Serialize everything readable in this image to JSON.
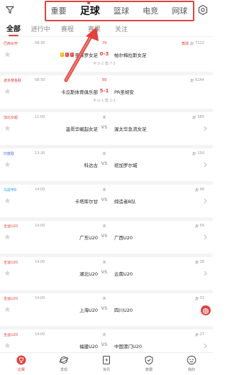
{
  "sport_tabs": [
    "重要",
    "足球",
    "篮球",
    "电竞",
    "网球"
  ],
  "sub_tabs": [
    "全部",
    "进行中",
    "赛程",
    "赛果",
    "关注"
  ],
  "colors": {
    "accent": "#e0433e",
    "card_yellow": "#f2b705"
  },
  "icons": {
    "filter": "filter-icon",
    "settings": "settings-icon",
    "star": "star-icon",
    "chevron": "chevron-right-icon",
    "fans": "people-icon"
  },
  "matches": [
    {
      "league": "巴西女杯",
      "league_color": "#e0433e",
      "time": "08:30",
      "status": "79",
      "tag": "角球",
      "fans": "7122",
      "home": "圣保罗女足",
      "away": "帕尔梅拉斯女足",
      "score": "0-3",
      "half": "半:0-2  角:7-3",
      "home_cards": [
        {
          "type": "y",
          "n": "2"
        },
        {
          "type": "r",
          "n": "1"
        },
        {
          "type": "r",
          "n": "3"
        }
      ]
    },
    {
      "league": "波多黎各联",
      "league_color": "#e0433e",
      "time": "08:30",
      "status": "89",
      "tag": "",
      "fans": "6244",
      "home": "卡瓜斯体育俱乐部",
      "away": "PR圣胡安",
      "score": "5-1",
      "half": "半:2-1  角:1-3",
      "home_cards": []
    },
    {
      "league": "加北女超",
      "league_color": "#e0433e",
      "time": "11:00",
      "status": "未",
      "tag": "",
      "fans": "585",
      "home": "温哥华崛起女足",
      "away": "渥太华急流女足",
      "score": "",
      "half": "",
      "home_cards": []
    },
    {
      "league": "印度联",
      "league_color": "#4a6fd8",
      "time": "13:30",
      "status": "未",
      "tag": "",
      "fans": "150",
      "home": "科达古",
      "away": "班加罗尔城",
      "score": "",
      "half": "",
      "home_cards": []
    },
    {
      "league": "乌兹甲B",
      "league_color": "#3aa8e0",
      "time": "14:00",
      "status": "未",
      "tag": "",
      "fans": "48",
      "home": "卡塔库尔甘",
      "away": "缔造者B队",
      "score": "",
      "half": "",
      "home_cards": []
    },
    {
      "league": "全运U20",
      "league_color": "#e0433e",
      "time": "14:00",
      "status": "未",
      "tag": "",
      "fans": "56",
      "home": "广东U20",
      "away": "广西U20",
      "score": "",
      "half": "",
      "home_cards": []
    },
    {
      "league": "全运U20",
      "league_color": "#e0433e",
      "time": "14:00",
      "status": "未",
      "tag": "",
      "fans": "28",
      "home": "湖北U20",
      "away": "云南U20",
      "score": "",
      "half": "",
      "home_cards": []
    },
    {
      "league": "全运U20",
      "league_color": "#e0433e",
      "time": "14:00",
      "status": "未",
      "tag": "",
      "fans": "33",
      "home": "上海U20",
      "away": "四川U20",
      "score": "",
      "half": "",
      "home_cards": []
    },
    {
      "league": "全运U20",
      "league_color": "#e0433e",
      "time": "14:00",
      "status": "未",
      "tag": "",
      "fans": "27",
      "home": "福建U20",
      "away": "中国澳门U20",
      "score": "",
      "half": "",
      "home_cards": []
    }
  ],
  "vs_label": "VS",
  "bottom_nav": [
    {
      "label": "比赛",
      "icon": "trophy-icon"
    },
    {
      "label": "发现",
      "icon": "planet-icon"
    },
    {
      "label": "资讯",
      "icon": "news-icon"
    },
    {
      "label": "数据",
      "icon": "shield-icon"
    },
    {
      "label": "我的",
      "icon": "profile-icon"
    }
  ]
}
